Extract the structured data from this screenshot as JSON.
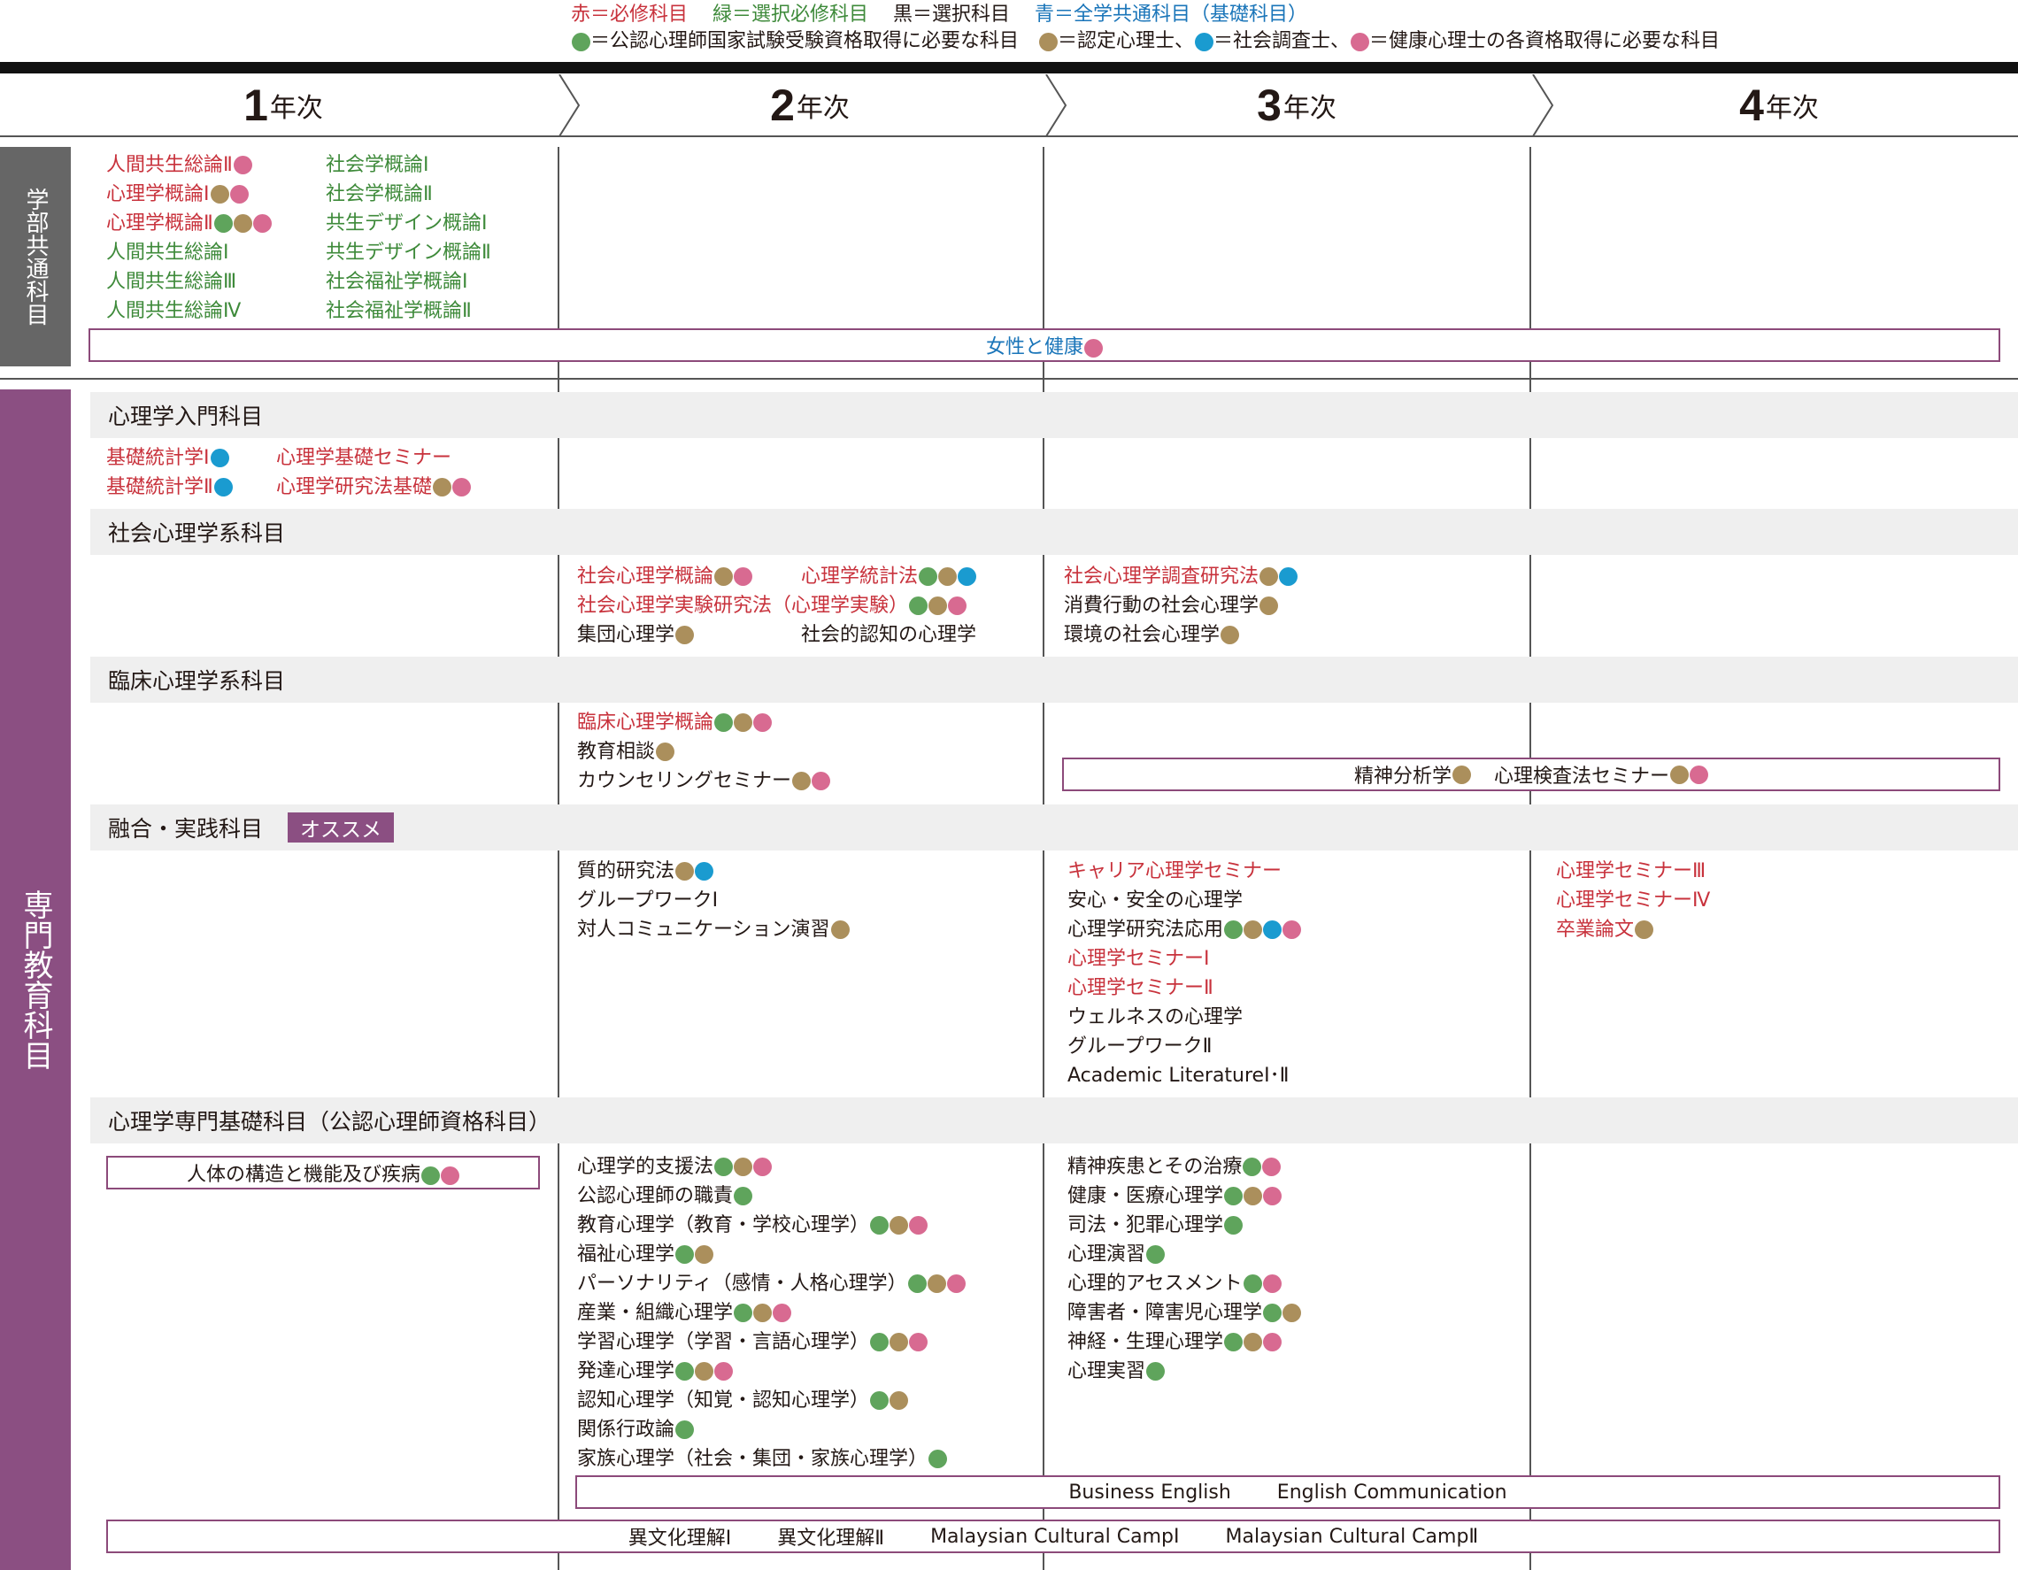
{
  "legend": {
    "line1": [
      {
        "text": "赤＝必修科目",
        "color": "red"
      },
      {
        "text": "緑＝選択必修科目",
        "color": "green"
      },
      {
        "text": "黒＝選択科目",
        "color": "black"
      },
      {
        "text": "青＝全学共通科目（基礎科目）",
        "color": "blue"
      }
    ],
    "line2_a": "＝公認心理師国家試験受験資格取得に必要な科目",
    "line2_b": "＝認定心理士、",
    "line2_c": "＝社会調査士、",
    "line2_d": "＝健康心理士の各資格取得に必要な科目"
  },
  "colors": {
    "red": "#c8323c",
    "green": "#3e8a3a",
    "blue": "#1a75b9",
    "dot_green": "#5fa45c",
    "dot_brown": "#ab8f5c",
    "dot_cyan": "#1a9bd0",
    "dot_pink": "#d86a91",
    "sidebar_gray": "#666666",
    "sidebar_purple": "#8b4f82"
  },
  "years": [
    {
      "num": "1",
      "label": "年次"
    },
    {
      "num": "2",
      "label": "年次"
    },
    {
      "num": "3",
      "label": "年次"
    },
    {
      "num": "4",
      "label": "年次"
    }
  ],
  "sidebar": {
    "common": "学部共通科目",
    "major": "専門教育科目"
  },
  "common": {
    "col1": [
      {
        "t": "人間共生総論Ⅱ",
        "c": "red",
        "d": [
          "p"
        ]
      },
      {
        "t": "心理学概論Ⅰ",
        "c": "red",
        "d": [
          "b",
          "p"
        ]
      },
      {
        "t": "心理学概論Ⅱ",
        "c": "red",
        "d": [
          "g",
          "b",
          "p"
        ]
      },
      {
        "t": "人間共生総論Ⅰ",
        "c": "green",
        "d": []
      },
      {
        "t": "人間共生総論Ⅲ",
        "c": "green",
        "d": []
      },
      {
        "t": "人間共生総論Ⅳ",
        "c": "green",
        "d": []
      }
    ],
    "col2": [
      {
        "t": "社会学概論Ⅰ",
        "c": "green",
        "d": []
      },
      {
        "t": "社会学概論Ⅱ",
        "c": "green",
        "d": []
      },
      {
        "t": "共生デザイン概論Ⅰ",
        "c": "green",
        "d": []
      },
      {
        "t": "共生デザイン概論Ⅱ",
        "c": "green",
        "d": []
      },
      {
        "t": "社会福祉学概論Ⅰ",
        "c": "green",
        "d": []
      },
      {
        "t": "社会福祉学概論Ⅱ",
        "c": "green",
        "d": []
      }
    ],
    "span": {
      "t": "女性と健康",
      "c": "blue",
      "d": [
        "p"
      ]
    }
  },
  "sections": {
    "intro": "心理学入門科目",
    "social": "社会心理学系科目",
    "clinical": "臨床心理学系科目",
    "fusion": "融合・実践科目",
    "fusion_badge": "オススメ",
    "basic": "心理学専門基礎科目（公認心理師資格科目）"
  },
  "intro": {
    "y1a": [
      {
        "t": "基礎統計学Ⅰ",
        "c": "red",
        "d": [
          "c"
        ]
      },
      {
        "t": "基礎統計学Ⅱ",
        "c": "red",
        "d": [
          "c"
        ]
      }
    ],
    "y1b": [
      {
        "t": "心理学基礎セミナー",
        "c": "red",
        "d": []
      },
      {
        "t": "心理学研究法基礎",
        "c": "red",
        "d": [
          "b",
          "p"
        ]
      }
    ]
  },
  "social": {
    "y2a": [
      {
        "t": "社会心理学概論",
        "c": "red",
        "d": [
          "b",
          "p"
        ]
      },
      {
        "t": "社会心理学実験研究法（心理学実験）",
        "c": "red",
        "d": [
          "g",
          "b",
          "p"
        ]
      },
      {
        "t": "集団心理学",
        "c": "black",
        "d": [
          "b"
        ]
      }
    ],
    "y2b_1": {
      "t": "心理学統計法",
      "c": "red",
      "d": [
        "g",
        "b",
        "c"
      ]
    },
    "y2b_3": {
      "t": "社会的認知の心理学",
      "c": "black",
      "d": []
    },
    "y3": [
      {
        "t": "社会心理学調査研究法",
        "c": "red",
        "d": [
          "b",
          "c"
        ]
      },
      {
        "t": "消費行動の社会心理学",
        "c": "black",
        "d": [
          "b"
        ]
      },
      {
        "t": "環境の社会心理学",
        "c": "black",
        "d": [
          "b"
        ]
      }
    ]
  },
  "clinical": {
    "y2": [
      {
        "t": "臨床心理学概論",
        "c": "red",
        "d": [
          "g",
          "b",
          "p"
        ]
      },
      {
        "t": "教育相談",
        "c": "black",
        "d": [
          "b"
        ]
      },
      {
        "t": "カウンセリングセミナー",
        "c": "black",
        "d": [
          "b",
          "p"
        ]
      }
    ],
    "span": [
      {
        "t": "精神分析学",
        "c": "black",
        "d": [
          "b"
        ]
      },
      {
        "t": "心理検査法セミナー",
        "c": "black",
        "d": [
          "b",
          "p"
        ]
      }
    ]
  },
  "fusion": {
    "y2": [
      {
        "t": "質的研究法",
        "c": "black",
        "d": [
          "b",
          "c"
        ]
      },
      {
        "t": "グループワークⅠ",
        "c": "black",
        "d": []
      },
      {
        "t": "対人コミュニケーション演習",
        "c": "black",
        "d": [
          "b"
        ]
      }
    ],
    "y3": [
      {
        "t": "キャリア心理学セミナー",
        "c": "red",
        "d": []
      },
      {
        "t": "安心・安全の心理学",
        "c": "black",
        "d": []
      },
      {
        "t": "心理学研究法応用",
        "c": "black",
        "d": [
          "g",
          "b",
          "c",
          "p"
        ]
      },
      {
        "t": "心理学セミナーⅠ",
        "c": "red",
        "d": []
      },
      {
        "t": "心理学セミナーⅡ",
        "c": "red",
        "d": []
      },
      {
        "t": "ウェルネスの心理学",
        "c": "black",
        "d": []
      },
      {
        "t": "グループワークⅡ",
        "c": "black",
        "d": []
      },
      {
        "t": "Academic LiteratureⅠ･Ⅱ",
        "c": "black",
        "d": []
      }
    ],
    "y4": [
      {
        "t": "心理学セミナーⅢ",
        "c": "red",
        "d": []
      },
      {
        "t": "心理学セミナーⅣ",
        "c": "red",
        "d": []
      },
      {
        "t": "卒業論文",
        "c": "red",
        "d": [
          "b"
        ]
      }
    ]
  },
  "basic": {
    "y1box": {
      "t": "人体の構造と機能及び疾病",
      "c": "black",
      "d": [
        "g",
        "p"
      ]
    },
    "y2": [
      {
        "t": "心理学的支援法",
        "c": "black",
        "d": [
          "g",
          "b",
          "p"
        ]
      },
      {
        "t": "公認心理師の職責",
        "c": "black",
        "d": [
          "g"
        ]
      },
      {
        "t": "教育心理学（教育・学校心理学）",
        "c": "black",
        "d": [
          "g",
          "b",
          "p"
        ]
      },
      {
        "t": "福祉心理学",
        "c": "black",
        "d": [
          "g",
          "b"
        ]
      },
      {
        "t": "パーソナリティ（感情・人格心理学）",
        "c": "black",
        "d": [
          "g",
          "b",
          "p"
        ]
      },
      {
        "t": "産業・組織心理学",
        "c": "black",
        "d": [
          "g",
          "b",
          "p"
        ]
      },
      {
        "t": "学習心理学（学習・言語心理学）",
        "c": "black",
        "d": [
          "g",
          "b",
          "p"
        ]
      },
      {
        "t": "発達心理学",
        "c": "black",
        "d": [
          "g",
          "b",
          "p"
        ]
      },
      {
        "t": "認知心理学（知覚・認知心理学）",
        "c": "black",
        "d": [
          "g",
          "b"
        ]
      },
      {
        "t": "関係行政論",
        "c": "black",
        "d": [
          "g"
        ]
      },
      {
        "t": "家族心理学（社会・集団・家族心理学）",
        "c": "black",
        "d": [
          "g"
        ]
      }
    ],
    "y3": [
      {
        "t": "精神疾患とその治療",
        "c": "black",
        "d": [
          "g",
          "p"
        ]
      },
      {
        "t": "健康・医療心理学",
        "c": "black",
        "d": [
          "g",
          "b",
          "p"
        ]
      },
      {
        "t": "司法・犯罪心理学",
        "c": "black",
        "d": [
          "g"
        ]
      },
      {
        "t": "心理演習",
        "c": "black",
        "d": [
          "g"
        ]
      },
      {
        "t": "心理的アセスメント",
        "c": "black",
        "d": [
          "g",
          "p"
        ]
      },
      {
        "t": "障害者・障害児心理学",
        "c": "black",
        "d": [
          "g",
          "b"
        ]
      },
      {
        "t": "神経・生理心理学",
        "c": "black",
        "d": [
          "g",
          "b",
          "p"
        ]
      },
      {
        "t": "心理実習",
        "c": "black",
        "d": [
          "g"
        ]
      }
    ],
    "english": [
      "Business English",
      "English Communication"
    ],
    "culture": [
      "異文化理解Ⅰ",
      "異文化理解Ⅱ",
      "Malaysian Cultural CampⅠ",
      "Malaysian Cultural CampⅡ"
    ]
  }
}
